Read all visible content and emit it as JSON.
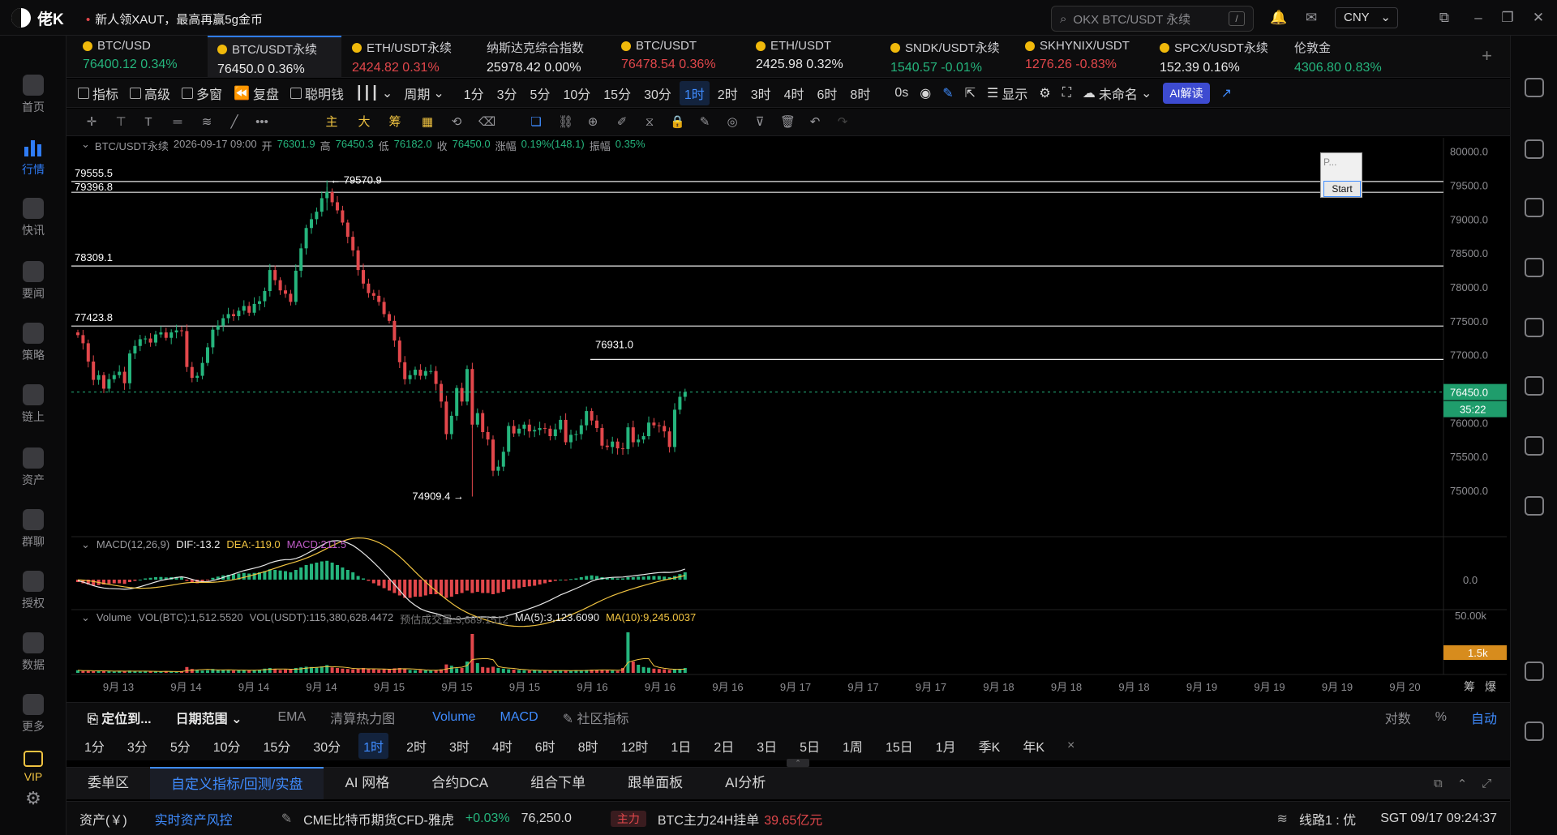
{
  "app": {
    "logo_text": "佬K",
    "announcement": "新人领XAUT，最高再赢5g金币",
    "search_placeholder": "OKX BTC/USDT 永续",
    "search_key": "/",
    "currency": "CNY"
  },
  "nav": [
    {
      "label": "首页"
    },
    {
      "label": "行情",
      "active": true
    },
    {
      "label": "快讯"
    },
    {
      "label": "要闻"
    },
    {
      "label": "策略"
    },
    {
      "label": "链上"
    },
    {
      "label": "资产"
    },
    {
      "label": "群聊"
    },
    {
      "label": "授权"
    },
    {
      "label": "数据"
    },
    {
      "label": "更多"
    },
    {
      "label": "VIP"
    }
  ],
  "tickers": [
    {
      "name": "BTC/USD",
      "price": "76400.12",
      "change": "0.34%",
      "dir": "up"
    },
    {
      "name": "BTC/USDT永续",
      "price": "76450.0",
      "change": "0.36%",
      "dir": "neutral",
      "active": true
    },
    {
      "name": "ETH/USDT永续",
      "price": "2424.82",
      "change": "0.31%",
      "dir": "down"
    },
    {
      "name": "纳斯达克综合指数",
      "price": "25978.42",
      "change": "0.00%",
      "dir": "neutral"
    },
    {
      "name": "BTC/USDT",
      "price": "76478.54",
      "change": "0.36%",
      "dir": "down"
    },
    {
      "name": "ETH/USDT",
      "price": "2425.98",
      "change": "0.32%",
      "dir": "neutral"
    },
    {
      "name": "SNDK/USDT永续",
      "price": "1540.57",
      "change": "-0.01%",
      "dir": "up"
    },
    {
      "name": "SKHYNIX/USDT",
      "price": "1276.26",
      "change": "-0.83%",
      "dir": "down"
    },
    {
      "name": "SPCX/USDT永续",
      "price": "152.39",
      "change": "0.16%",
      "dir": "neutral"
    },
    {
      "name": "伦敦金",
      "price": "4306.80",
      "change": "0.83%",
      "dir": "up"
    }
  ],
  "toolbar": {
    "indicator": "指标",
    "advanced": "高级",
    "multi": "多窗",
    "replay": "复盘",
    "smart": "聪明钱",
    "cycle": "周期",
    "periods": [
      "1分",
      "3分",
      "5分",
      "10分",
      "15分",
      "30分",
      "1时",
      "2时",
      "3时",
      "4时",
      "6时",
      "8时"
    ],
    "active_period": "1时",
    "delay": "0s",
    "display": "显示",
    "unnamed": "未命名",
    "ai": "AI解读"
  },
  "chart_header": {
    "symbol": "BTC/USDT永续",
    "time": "2026-09-17 09:00",
    "open_l": "开",
    "open": "76301.9",
    "high_l": "高",
    "high": "76450.3",
    "low_l": "低",
    "low": "76182.0",
    "close_l": "收",
    "close": "76450.0",
    "chg_l": "涨幅",
    "chg": "0.19%(148.1)",
    "amp_l": "振幅",
    "amp": "0.35%"
  },
  "macd_header": {
    "name": "MACD(12,26,9)",
    "dif": "DIF:-13.2",
    "dea": "DEA:-119.0",
    "macd": "MACD:211.5"
  },
  "vol_header": {
    "name": "Volume",
    "vol_btc": "VOL(BTC):1,512.5520",
    "vol_usdt": "VOL(USDT):115,380,628.4472",
    "est": "预估成交量:3,689.1512",
    "ma5": "MA(5):3,123.6090",
    "ma10": "MA(10):9,245.0037"
  },
  "price_labels": {
    "current": "76450.0",
    "countdown": "35:22",
    "vol_current": "1.5k",
    "macd_zero": "0.0",
    "vol_top": "50.00k"
  },
  "popup": {
    "title": "P...",
    "start": "Start"
  },
  "bottom": {
    "locate": "定位到...",
    "range": "日期范围",
    "ema": "EMA",
    "heat": "清算热力图",
    "volume": "Volume",
    "macd": "MACD",
    "community": "社区指标",
    "log": "对数",
    "pct": "%",
    "auto": "自动"
  },
  "bottom_periods": [
    "1分",
    "3分",
    "5分",
    "10分",
    "15分",
    "30分",
    "1时",
    "2时",
    "3时",
    "4时",
    "6时",
    "8时",
    "12时",
    "1日",
    "2日",
    "3日",
    "5日",
    "1周",
    "15日",
    "1月",
    "季K",
    "年K"
  ],
  "bottom_tabs": [
    "委单区",
    "自定义指标/回测/实盘",
    "AI 网格",
    "合约DCA",
    "组合下单",
    "跟单面板",
    "AI分析"
  ],
  "status": {
    "asset": "资产(￥)",
    "risk": "实时资产风控",
    "cme": "CME比特币期货CFD-雅虎",
    "cme_chg": "+0.03%",
    "cme_price": "76,250.0",
    "tag": "主力",
    "main": "BTC主力24H挂单",
    "main_val": "39.65亿元",
    "line": "线路1 : 优",
    "time": "SGT 09/17 09:24:37"
  },
  "chart_data": {
    "type": "candlestick",
    "y_ticks": [
      "80000.0",
      "79500.0",
      "79000.0",
      "78500.0",
      "78000.0",
      "77500.0",
      "77000.0",
      "76500.0",
      "76000.0",
      "75500.0",
      "75000.0"
    ],
    "ylim": [
      74700,
      80200
    ],
    "x_ticks": [
      "9月 13",
      "9月 14",
      "9月 14",
      "9月 14",
      "9月 15",
      "9月 15",
      "9月 15",
      "9月 16",
      "9月 16",
      "9月 16",
      "9月 17",
      "9月 17",
      "9月 17",
      "9月 18",
      "9月 18",
      "9月 18",
      "9月 19",
      "9月 19",
      "9月 19",
      "9月 20"
    ],
    "x_tick_tail": [
      "筹",
      "爆"
    ],
    "hlines": [
      {
        "value": 79555.5,
        "label": "79555.5"
      },
      {
        "value": 79396.8,
        "label": "79396.8"
      },
      {
        "value": 78309.1,
        "label": "78309.1"
      },
      {
        "value": 77423.8,
        "label": "77423.8"
      },
      {
        "value": 76931.0,
        "label": "76931.0"
      }
    ],
    "annotations": [
      {
        "label": "79570.9",
        "value": 79570.9
      },
      {
        "label": "74909.4",
        "value": 74909.4
      },
      {
        "label": "76931.0",
        "value": 76931.0
      }
    ],
    "closes": [
      77290,
      77170,
      76900,
      76630,
      76700,
      76500,
      76640,
      76700,
      76750,
      76580,
      77020,
      77130,
      77230,
      77240,
      77180,
      77300,
      77330,
      77250,
      77330,
      77360,
      77350,
      76820,
      76660,
      76690,
      76880,
      77110,
      77370,
      77430,
      77540,
      77600,
      77570,
      77650,
      77720,
      77620,
      77750,
      77790,
      77940,
      78250,
      78100,
      77950,
      77900,
      77780,
      78240,
      78570,
      78870,
      79000,
      79110,
      79310,
      79400,
      79250,
      79130,
      78950,
      78740,
      78540,
      78250,
      78050,
      77910,
      77870,
      77780,
      77600,
      77500,
      77210,
      76890,
      76640,
      76700,
      76780,
      76690,
      76760,
      76760,
      76570,
      76310,
      75830,
      76100,
      76510,
      76310,
      76790,
      75970,
      76140,
      75860,
      75750,
      75290,
      75350,
      75570,
      75950,
      75840,
      75910,
      75970,
      75870,
      75890,
      75920,
      75910,
      75800,
      75900,
      76040,
      75710,
      75820,
      75830,
      75960,
      76170,
      76030,
      75920,
      75660,
      75640,
      75720,
      75620,
      75610,
      75930,
      75710,
      75750,
      75800,
      76000,
      75960,
      75950,
      75870,
      75640,
      76190,
      76380,
      76450
    ],
    "macd_hist": [
      -20,
      -30,
      -40,
      -50,
      -45,
      -40,
      -35,
      -30,
      -30,
      -35,
      -20,
      -10,
      0,
      10,
      15,
      20,
      22,
      18,
      20,
      22,
      20,
      -10,
      -25,
      -30,
      -20,
      -5,
      15,
      25,
      35,
      40,
      45,
      50,
      55,
      50,
      55,
      60,
      70,
      85,
      80,
      75,
      70,
      60,
      80,
      100,
      120,
      130,
      140,
      150,
      155,
      140,
      120,
      100,
      80,
      60,
      30,
      10,
      -10,
      -30,
      -50,
      -70,
      -90,
      -110,
      -130,
      -150,
      -150,
      -140,
      -140,
      -130,
      -120,
      -120,
      -130,
      -150,
      -140,
      -120,
      -110,
      -90,
      -110,
      -100,
      -110,
      -110,
      -120,
      -110,
      -100,
      -80,
      -75,
      -70,
      -60,
      -55,
      -50,
      -40,
      -30,
      -20,
      -10,
      0,
      -5,
      5,
      10,
      20,
      30,
      35,
      30,
      20,
      15,
      15,
      10,
      10,
      20,
      20,
      25,
      25,
      30,
      30,
      30,
      25,
      20,
      30,
      45,
      60
    ],
    "volume": [
      800,
      600,
      700,
      500,
      600,
      700,
      500,
      400,
      600,
      500,
      700,
      500,
      400,
      500,
      400,
      500,
      400,
      500,
      400,
      300,
      400,
      1800,
      1200,
      900,
      700,
      800,
      1200,
      900,
      1000,
      800,
      700,
      800,
      900,
      800,
      900,
      1000,
      1300,
      1500,
      1200,
      900,
      1000,
      1100,
      1500,
      1700,
      1900,
      1800,
      1600,
      2000,
      2400,
      1700,
      1500,
      1300,
      1200,
      1100,
      1300,
      1500,
      1200,
      1100,
      1000,
      1100,
      1200,
      1400,
      1500,
      1200,
      900,
      800,
      900,
      800,
      700,
      800,
      1100,
      2600,
      2200,
      1400,
      1500,
      3500,
      12000,
      3000,
      1800,
      1600,
      1900,
      1500,
      1300,
      1100,
      1000,
      900,
      800,
      700,
      800,
      700,
      800,
      600,
      700,
      800,
      700,
      600,
      800,
      700,
      900,
      1000,
      900,
      1000,
      800,
      700,
      600,
      1500,
      12500,
      3500,
      2500,
      1800,
      1600,
      1300,
      1200,
      1100,
      900,
      1000,
      1200,
      1500
    ]
  }
}
